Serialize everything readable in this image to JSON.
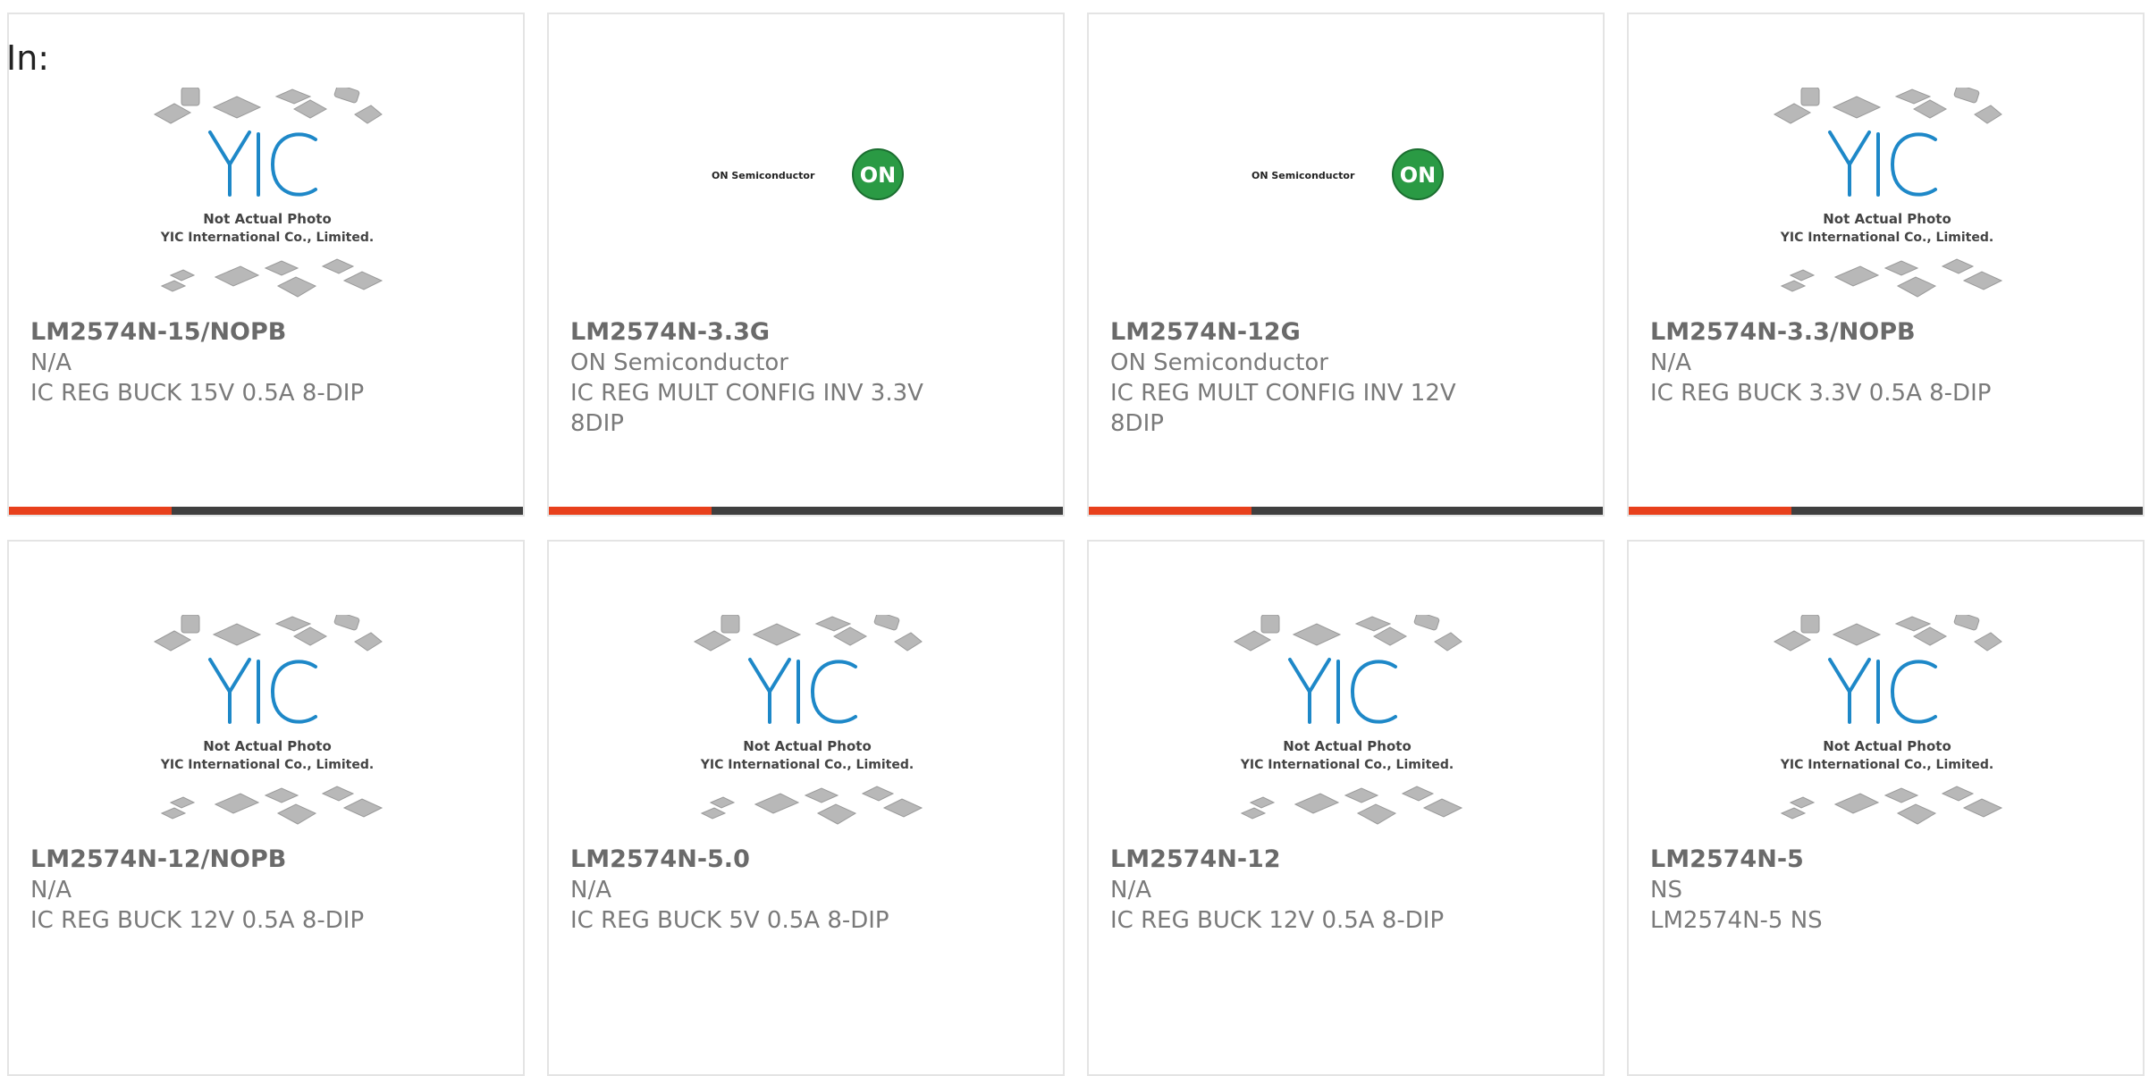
{
  "page": {
    "label": "In:"
  },
  "colors": {
    "accent": "#e8401c",
    "bar_dark": "#3f3f3f",
    "yic_blue": "#1e88c8",
    "on_green": "#2a9a44"
  },
  "products": [
    {
      "part": "LM2574N-15/NOPB",
      "manufacturer": "N/A",
      "description": "IC REG BUCK 15V 0.5A 8-DIP",
      "image": "yic-placeholder",
      "image_caption": "Not Actual Photo",
      "image_caption2": "YIC International Co., Limited."
    },
    {
      "part": "LM2574N-3.3G",
      "manufacturer": "ON Semiconductor",
      "description": "IC REG MULT CONFIG INV 3.3V 8DIP",
      "image": "on-semiconductor-logo",
      "logo_text": "ON Semiconductor",
      "logo_mark": "ON"
    },
    {
      "part": "LM2574N-12G",
      "manufacturer": "ON Semiconductor",
      "description": "IC REG MULT CONFIG INV 12V 8DIP",
      "image": "on-semiconductor-logo",
      "logo_text": "ON Semiconductor",
      "logo_mark": "ON"
    },
    {
      "part": "LM2574N-3.3/NOPB",
      "manufacturer": "N/A",
      "description": "IC REG BUCK 3.3V 0.5A 8-DIP",
      "image": "yic-placeholder",
      "image_caption": "Not Actual Photo",
      "image_caption2": "YIC International Co., Limited."
    },
    {
      "part": "LM2574N-12/NOPB",
      "manufacturer": "N/A",
      "description": "IC REG BUCK 12V 0.5A 8-DIP",
      "image": "yic-placeholder",
      "image_caption": "Not Actual Photo",
      "image_caption2": "YIC International Co., Limited."
    },
    {
      "part": "LM2574N-5.0",
      "manufacturer": "N/A",
      "description": "IC REG BUCK 5V 0.5A 8-DIP",
      "image": "yic-placeholder",
      "image_caption": "Not Actual Photo",
      "image_caption2": "YIC International Co., Limited."
    },
    {
      "part": "LM2574N-12",
      "manufacturer": "N/A",
      "description": "IC REG BUCK 12V 0.5A 8-DIP",
      "image": "yic-placeholder",
      "image_caption": "Not Actual Photo",
      "image_caption2": "YIC International Co., Limited."
    },
    {
      "part": "LM2574N-5",
      "manufacturer": "NS",
      "description": "LM2574N-5 NS",
      "image": "yic-placeholder",
      "image_caption": "Not Actual Photo",
      "image_caption2": "YIC International Co., Limited."
    }
  ]
}
